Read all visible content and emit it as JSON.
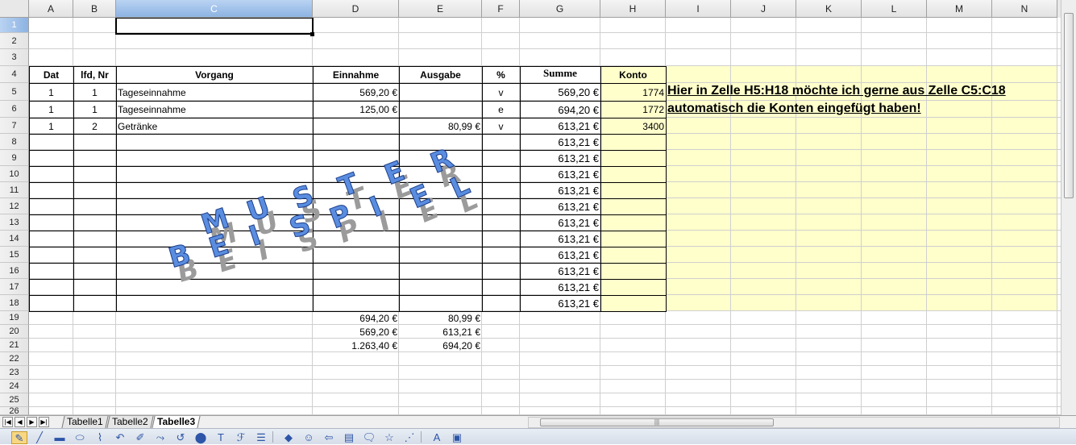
{
  "columns": [
    "A",
    "B",
    "C",
    "D",
    "E",
    "F",
    "G",
    "H",
    "I",
    "J",
    "K",
    "L",
    "M",
    "N"
  ],
  "rows": [
    "1",
    "2",
    "3",
    "4",
    "5",
    "6",
    "7",
    "8",
    "9",
    "10",
    "11",
    "12",
    "13",
    "14",
    "15",
    "16",
    "17",
    "18",
    "19",
    "20",
    "21",
    "22",
    "23",
    "24",
    "25",
    "26"
  ],
  "selected_cell": "C1",
  "headers": {
    "dat": "Dat",
    "lfd_nr": "lfd, Nr",
    "vorgang": "Vorgang",
    "einnahme": "Einnahme",
    "ausgabe": "Ausgabe",
    "percent": "%",
    "summe": "Summe",
    "konto": "Konto"
  },
  "entries": [
    {
      "dat": "1",
      "lfd": "1",
      "vorgang": "Tageseinnahme",
      "einnahme": "569,20 €",
      "ausgabe": "",
      "pct": "v",
      "summe": "569,20 €",
      "konto": "1774"
    },
    {
      "dat": "1",
      "lfd": "1",
      "vorgang": "Tageseinnahme",
      "einnahme": "125,00 €",
      "ausgabe": "",
      "pct": "e",
      "summe": "694,20 €",
      "konto": "1772"
    },
    {
      "dat": "1",
      "lfd": "2",
      "vorgang": "Getränke",
      "einnahme": "",
      "ausgabe": "80,99 €",
      "pct": "v",
      "summe": "613,21 €",
      "konto": "3400"
    }
  ],
  "summe_repeat": [
    "613,21 €",
    "613,21 €",
    "613,21 €",
    "613,21 €",
    "613,21 €",
    "613,21 €",
    "613,21 €",
    "613,21 €",
    "613,21 €",
    "613,21 €",
    "613,21 €"
  ],
  "totals": [
    {
      "einnahme": "694,20 €",
      "ausgabe": "80,99 €"
    },
    {
      "einnahme": "569,20 €",
      "ausgabe": "613,21 €"
    },
    {
      "einnahme": "1.263,40 €",
      "ausgabe": "694,20 €"
    }
  ],
  "note": {
    "line1": "Hier in Zelle H5:H18 möchte ich gerne aus Zelle C5:C18",
    "line2": "automatisch die Konten eingefügt haben!"
  },
  "wordart": {
    "word1": "MUSTER",
    "word2": "BEISPIEL",
    "fill_color": "#5a8de0",
    "shadow_color": "#9b9b9b"
  },
  "colors": {
    "highlight_yellow": "#ffffcc",
    "header_selected": "#8db3e2"
  },
  "sheet_tabs": [
    {
      "label": "Tabelle1",
      "active": false
    },
    {
      "label": "Tabelle2",
      "active": false
    },
    {
      "label": "Tabelle3",
      "active": true
    }
  ],
  "nav_buttons": [
    "first-sheet",
    "prev-sheet",
    "next-sheet",
    "last-sheet"
  ],
  "hscroll_grip": "|||",
  "draw_toolbar": [
    {
      "icon": "select-icon",
      "glyph": "✎"
    },
    {
      "icon": "line-icon",
      "glyph": "╱"
    },
    {
      "icon": "rectangle-icon",
      "glyph": "▬"
    },
    {
      "icon": "ellipse-icon",
      "glyph": "⬭"
    },
    {
      "icon": "freeform-icon",
      "glyph": "⌇"
    },
    {
      "icon": "curve-icon",
      "glyph": "↶"
    },
    {
      "icon": "pen-icon",
      "glyph": "✐"
    },
    {
      "icon": "connector-icon",
      "glyph": "⤳"
    },
    {
      "icon": "arc-icon",
      "glyph": "↺"
    },
    {
      "icon": "bubble-icon",
      "glyph": "⬤"
    },
    {
      "icon": "text-icon",
      "glyph": "T"
    },
    {
      "icon": "fontwork-icon",
      "glyph": "ℱ"
    },
    {
      "icon": "comment-icon",
      "glyph": "☰"
    },
    {
      "icon": "basic-shapes-icon",
      "glyph": "◆"
    },
    {
      "icon": "symbol-shapes-icon",
      "glyph": "☺"
    },
    {
      "icon": "block-arrows-icon",
      "glyph": "⇦"
    },
    {
      "icon": "flowchart-icon",
      "glyph": "▤"
    },
    {
      "icon": "callouts-icon",
      "glyph": "🗨"
    },
    {
      "icon": "stars-icon",
      "glyph": "☆"
    },
    {
      "icon": "points-icon",
      "glyph": "⋰"
    },
    {
      "icon": "fontwork-gallery-icon",
      "glyph": "A"
    },
    {
      "icon": "from-file-icon",
      "glyph": "▣"
    }
  ]
}
